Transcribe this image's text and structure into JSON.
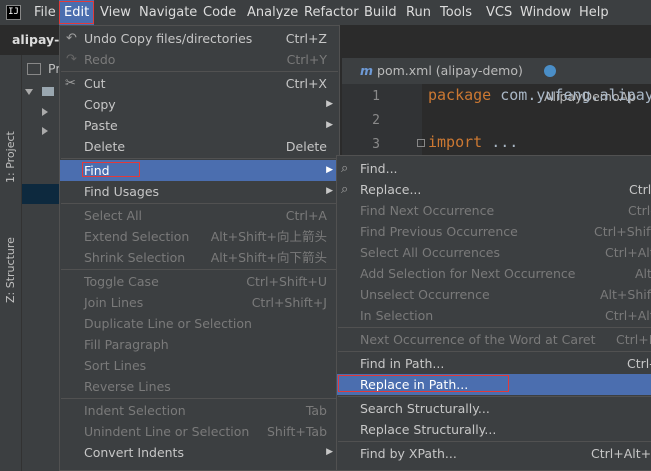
{
  "menubar": {
    "logo": "IJ",
    "items": [
      "File",
      "Edit",
      "View",
      "Navigate",
      "Code",
      "Analyze",
      "Refactor",
      "Build",
      "Run",
      "Tools",
      "VCS",
      "Window",
      "Help"
    ]
  },
  "project": {
    "title": "alipay-d",
    "panel_label": "Pr",
    "tool_tabs": [
      "1: Project",
      "Z: Structure"
    ]
  },
  "editor": {
    "tabs": [
      "pom.xml (alipay-demo)",
      "AlipayDemoAp"
    ],
    "tab_icon_m": "m",
    "line_numbers": [
      "1",
      "2",
      "3"
    ],
    "code_keyword_package": "package",
    "code_package_name": " com.yufeng.alipay",
    "code_keyword_import": "import",
    "code_import_rest": " ..."
  },
  "edit_menu": {
    "items": [
      {
        "label": "Undo Copy files/directories",
        "shortcut": "Ctrl+Z",
        "icon": "undo-icon"
      },
      {
        "label": "Redo",
        "shortcut": "Ctrl+Y",
        "icon": "redo-icon"
      },
      {
        "label": "Cut",
        "shortcut": "Ctrl+X",
        "icon": "cut-icon"
      },
      {
        "label": "Copy",
        "shortcut": ""
      },
      {
        "label": "Paste",
        "shortcut": ""
      },
      {
        "label": "Delete",
        "shortcut": "Delete"
      },
      {
        "label": "Find",
        "shortcut": ""
      },
      {
        "label": "Find Usages",
        "shortcut": ""
      },
      {
        "label": "Select All",
        "shortcut": "Ctrl+A"
      },
      {
        "label": "Extend Selection",
        "shortcut": "Alt+Shift+向上箭头"
      },
      {
        "label": "Shrink Selection",
        "shortcut": "Alt+Shift+向下箭头"
      },
      {
        "label": "Toggle Case",
        "shortcut": "Ctrl+Shift+U"
      },
      {
        "label": "Join Lines",
        "shortcut": "Ctrl+Shift+J"
      },
      {
        "label": "Duplicate Line or Selection",
        "shortcut": ""
      },
      {
        "label": "Fill Paragraph",
        "shortcut": ""
      },
      {
        "label": "Sort Lines",
        "shortcut": ""
      },
      {
        "label": "Reverse Lines",
        "shortcut": ""
      },
      {
        "label": "Indent Selection",
        "shortcut": "Tab"
      },
      {
        "label": "Unindent Line or Selection",
        "shortcut": "Shift+Tab"
      },
      {
        "label": "Convert Indents",
        "shortcut": ""
      }
    ]
  },
  "find_menu": {
    "items": [
      {
        "label": "Find...",
        "shortcut": "",
        "icon": "search-icon"
      },
      {
        "label": "Replace...",
        "shortcut": "Ctrl",
        "icon": "replace-icon"
      },
      {
        "label": "Find Next Occurrence",
        "shortcut": "Ctrl-"
      },
      {
        "label": "Find Previous Occurrence",
        "shortcut": "Ctrl+Shift"
      },
      {
        "label": "Select All Occurrences",
        "shortcut": "Ctrl+Alt"
      },
      {
        "label": "Add Selection for Next Occurrence",
        "shortcut": "Alt"
      },
      {
        "label": "Unselect Occurrence",
        "shortcut": "Alt+Shift"
      },
      {
        "label": "In Selection",
        "shortcut": "Ctrl+Alt"
      },
      {
        "label": "Next Occurrence of the Word at Caret",
        "shortcut": "Ctrl+F"
      },
      {
        "label": "Find in Path...",
        "shortcut": "Ctrl-"
      },
      {
        "label": "Replace in Path...",
        "shortcut": ""
      },
      {
        "label": "Search Structurally...",
        "shortcut": ""
      },
      {
        "label": "Replace Structurally...",
        "shortcut": ""
      },
      {
        "label": "Find by XPath...",
        "shortcut": "Ctrl+Alt+X"
      }
    ]
  },
  "colors": {
    "highlight": "#4b6eaf",
    "menu_bg": "#3c3f41",
    "editor_bg": "#2b2b2b",
    "annotation_box": "#e23a3a"
  }
}
